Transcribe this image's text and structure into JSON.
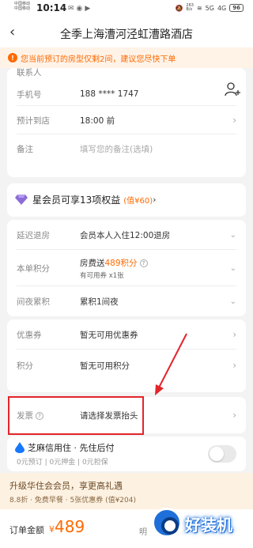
{
  "status_bar": {
    "carrier1": "中国移动",
    "carrier2": "中国移动",
    "time": "10:14",
    "net_speed_value": "263",
    "net_speed_unit": "B/s",
    "signal_label1": "5G",
    "signal_label2": "4G",
    "battery": "96"
  },
  "nav": {
    "title": "全季上海漕河泾虹漕路酒店"
  },
  "notice": {
    "text": "您当前预订的房型仅剩2间，建议您尽快下单"
  },
  "guest_info": {
    "contact_label": "联系人",
    "phone_label": "手机号",
    "phone_value": "188 **** 1747",
    "arrival_label": "预计到店",
    "arrival_value": "18:00 前",
    "note_label": "备注",
    "note_placeholder": "填写您的备注(选填)"
  },
  "membership": {
    "title": "星会员可享13项权益",
    "value": "(值¥60)"
  },
  "benefits": {
    "late_checkout_label": "延迟退房",
    "late_checkout_value": "会员本人入住12:00退房",
    "points_label": "本单积分",
    "points_value_prefix": "房费送",
    "points_value_highlight": "489积分",
    "points_sub": "有可用券 x1张",
    "nights_label": "间夜累积",
    "nights_value": "累积1间夜"
  },
  "discounts": {
    "coupon_label": "优惠券",
    "coupon_value": "暂无可用优惠券",
    "points_label": "积分",
    "points_value": "暂无可用积分"
  },
  "invoice": {
    "label": "发票",
    "value": "请选择发票抬头"
  },
  "sesame": {
    "title": "芝麻信用住 · 先住后付",
    "sub": "0元预订 | 0元押金 | 0元担保"
  },
  "upsell": {
    "title": "升级华住会会员，享更高礼遇",
    "line": "8.8折 · 免费早餐 · 5张优惠券 (值¥204)"
  },
  "footer": {
    "amount_label": "订单金额",
    "currency": "¥",
    "amount": "489",
    "detail": "明"
  },
  "watermark": {
    "text": "好装机"
  },
  "colors": {
    "accent": "#ff6a00",
    "highlight_box": "#e3242b"
  }
}
